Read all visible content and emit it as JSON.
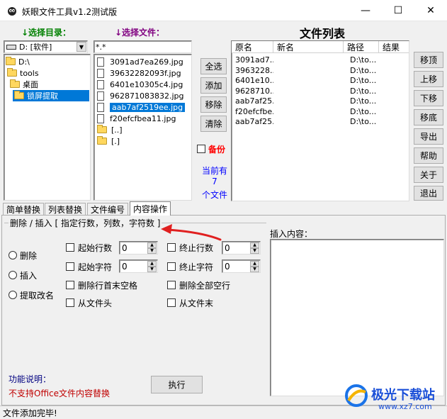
{
  "window": {
    "title": "妖眼文件工具v1.2测试版",
    "minimize_glyph": "—",
    "maximize_glyph": "☐",
    "close_glyph": "✕"
  },
  "left": {
    "dir_label": "↓选择目录：",
    "drive": "D: [软件]",
    "tree": [
      "D:\\",
      "tools",
      "桌面",
      "锁屏提取"
    ]
  },
  "middle": {
    "file_label": "↓选择文件：",
    "filter": "*.*",
    "files": [
      "3091ad7ea269.jpg",
      "39632282093f.jpg",
      "6401e10305c4.jpg",
      "962871083832.jpg",
      "aab7af2519ee.jpg",
      "f20efcfbea11.jpg"
    ],
    "dirs": [
      "[..]",
      "[.]"
    ]
  },
  "actions": {
    "select_all": "全选",
    "add": "添加",
    "remove": "移除",
    "clear": "清除",
    "backup": "备份",
    "current_has": "当前有",
    "count": "7",
    "files_unit": "个文件"
  },
  "file_list": {
    "title": "文件列表",
    "columns": [
      "原名",
      "新名",
      "路径",
      "结果"
    ],
    "rows": [
      {
        "orig": "3091ad7...",
        "new": "",
        "path": "D:\\to...",
        "result": ""
      },
      {
        "orig": "3963228...",
        "new": "",
        "path": "D:\\to...",
        "result": ""
      },
      {
        "orig": "6401e10...",
        "new": "",
        "path": "D:\\to...",
        "result": ""
      },
      {
        "orig": "9628710...",
        "new": "",
        "path": "D:\\to...",
        "result": ""
      },
      {
        "orig": "aab7af25...",
        "new": "",
        "path": "D:\\to...",
        "result": ""
      },
      {
        "orig": "f20efcfbe...",
        "new": "",
        "path": "D:\\to...",
        "result": ""
      },
      {
        "orig": "aab7af25...",
        "new": "",
        "path": "D:\\to...",
        "result": ""
      }
    ]
  },
  "side_buttons": [
    "移顶",
    "上移",
    "下移",
    "移底",
    "导出",
    "帮助",
    "关于",
    "退出"
  ],
  "tabs": [
    "简单替换",
    "列表替换",
    "文件编号",
    "内容操作"
  ],
  "active_tab": 3,
  "content_ops": {
    "group_title": "删除 / 插入 [ 指定行数，列数，字符数 ]",
    "radio_delete": "删除",
    "radio_insert": "插入",
    "radio_extract": "提取改名",
    "start_line": "起始行数",
    "start_line_value": "0",
    "start_char": "起始字符",
    "start_char_value": "0",
    "end_line": "终止行数",
    "end_line_value": "0",
    "end_char": "终止字符",
    "end_char_value": "0",
    "trim_lines": "删除行首末空格",
    "delete_blank": "删除全部空行",
    "from_head": "从文件头",
    "from_tail": "从文件末",
    "insert_label": "插入内容：",
    "func_label": "功能说明：",
    "func_note": "不支持Office文件内容替换",
    "execute": "执行"
  },
  "status": "文件添加完毕!",
  "watermark": {
    "name": "极光下载站",
    "url": "www.xz7.com"
  },
  "colors": {
    "selection": "#0078d7",
    "green": "#008000",
    "purple": "#800080",
    "red": "#ff0000",
    "annotation_arrow": "#e02020"
  }
}
